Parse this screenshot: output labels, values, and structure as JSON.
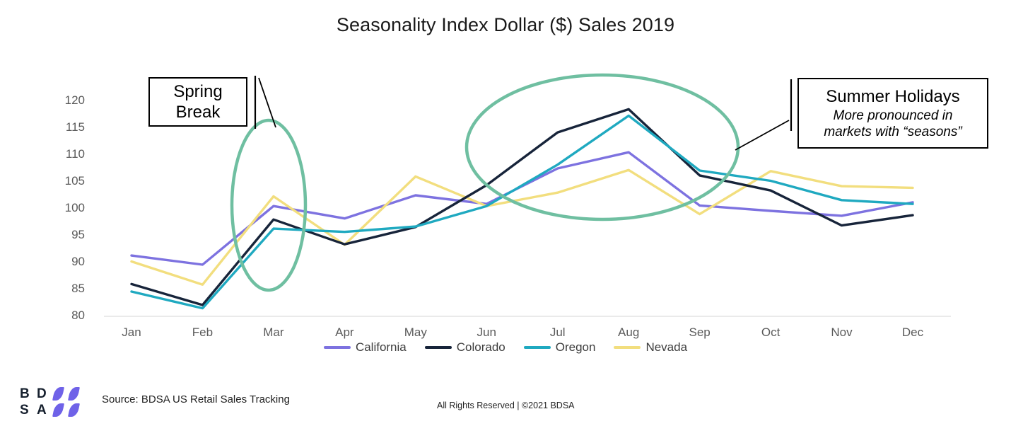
{
  "chart_data": {
    "type": "line",
    "title": "Seasonality Index Dollar ($) Sales 2019",
    "xlabel": "",
    "ylabel": "",
    "ylim": [
      80,
      120
    ],
    "yticks": [
      80,
      85,
      90,
      95,
      100,
      105,
      110,
      115,
      120
    ],
    "grid": false,
    "legend_position": "bottom",
    "categories": [
      "Jan",
      "Feb",
      "Mar",
      "Apr",
      "May",
      "Jun",
      "Jul",
      "Aug",
      "Sep",
      "Oct",
      "Nov",
      "Dec"
    ],
    "series": [
      {
        "name": "California",
        "color": "#7d72e0",
        "values": [
          91.3,
          89.6,
          100.5,
          98.2,
          102.5,
          100.9,
          107.5,
          110.5,
          100.6,
          99.6,
          98.7,
          101.2
        ]
      },
      {
        "name": "Colorado",
        "color": "#17243a",
        "values": [
          86.0,
          82.1,
          98.0,
          93.4,
          96.6,
          104.4,
          114.2,
          118.5,
          106.2,
          103.4,
          96.9,
          98.8
        ]
      },
      {
        "name": "Oregon",
        "color": "#1fa9c0",
        "values": [
          84.6,
          81.5,
          96.3,
          95.7,
          96.7,
          100.5,
          108.2,
          117.3,
          107.1,
          105.2,
          101.6,
          100.9
        ]
      },
      {
        "name": "Nevada",
        "color": "#f2de7e",
        "values": [
          90.2,
          85.9,
          102.3,
          93.3,
          106.0,
          100.5,
          103.0,
          107.2,
          99.0,
          107.0,
          104.2,
          103.9
        ]
      }
    ]
  },
  "annotations": {
    "spring": {
      "title": "Spring\nBreak",
      "title_line1": "Spring",
      "title_line2": "Break"
    },
    "summer": {
      "title": "Summer Holidays",
      "subtitle": "More pronounced in\nmarkets with “seasons”",
      "subtitle_line1": "More pronounced in",
      "subtitle_line2": "markets with “seasons”"
    },
    "highlight_color": "#6fbfa1"
  },
  "footer": {
    "source": "Source:  BDSA US Retail Sales Tracking",
    "rights": "All Rights Reserved | ©2021 BDSA"
  },
  "brand": {
    "letters": [
      "B",
      "D",
      "S",
      "A"
    ],
    "accent_color": "#6f62e8"
  }
}
